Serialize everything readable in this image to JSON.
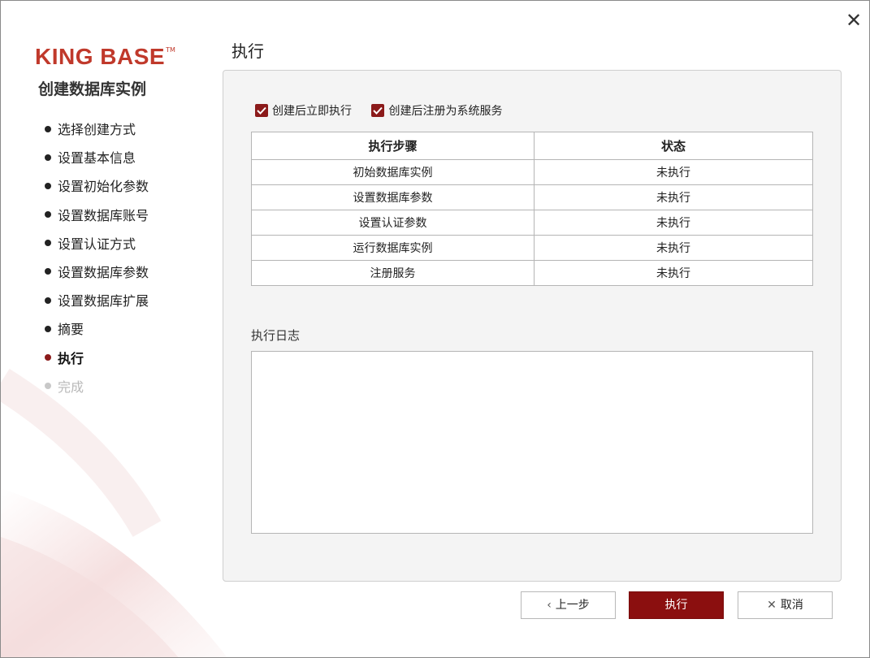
{
  "window": {
    "close_glyph": "✕"
  },
  "brand": {
    "logo_text": "KING BASE",
    "logo_tm": "TM",
    "brand_color": "#c0392b"
  },
  "sidebar": {
    "title": "创建数据库实例",
    "steps": [
      {
        "label": "选择创建方式",
        "state": "done"
      },
      {
        "label": "设置基本信息",
        "state": "done"
      },
      {
        "label": "设置初始化参数",
        "state": "done"
      },
      {
        "label": "设置数据库账号",
        "state": "done"
      },
      {
        "label": "设置认证方式",
        "state": "done"
      },
      {
        "label": "设置数据库参数",
        "state": "done"
      },
      {
        "label": "设置数据库扩展",
        "state": "done"
      },
      {
        "label": "摘要",
        "state": "done"
      },
      {
        "label": "执行",
        "state": "active"
      },
      {
        "label": "完成",
        "state": "pending"
      }
    ]
  },
  "main": {
    "title": "执行",
    "options": [
      {
        "label": "创建后立即执行",
        "checked": true
      },
      {
        "label": "创建后注册为系统服务",
        "checked": true
      }
    ],
    "table": {
      "headers": [
        "执行步骤",
        "状态"
      ],
      "rows": [
        [
          "初始数据库实例",
          "未执行"
        ],
        [
          "设置数据库参数",
          "未执行"
        ],
        [
          "设置认证参数",
          "未执行"
        ],
        [
          "运行数据库实例",
          "未执行"
        ],
        [
          "注册服务",
          "未执行"
        ]
      ]
    },
    "log_label": "执行日志",
    "log_text": ""
  },
  "footer": {
    "prev_label": "上一步",
    "prev_icon": "chevron-left-icon",
    "execute_label": "执行",
    "cancel_label": "取消",
    "cancel_icon": "close-icon"
  },
  "colors": {
    "accent": "#8b0f0f",
    "panel_bg": "#f4f4f4"
  }
}
